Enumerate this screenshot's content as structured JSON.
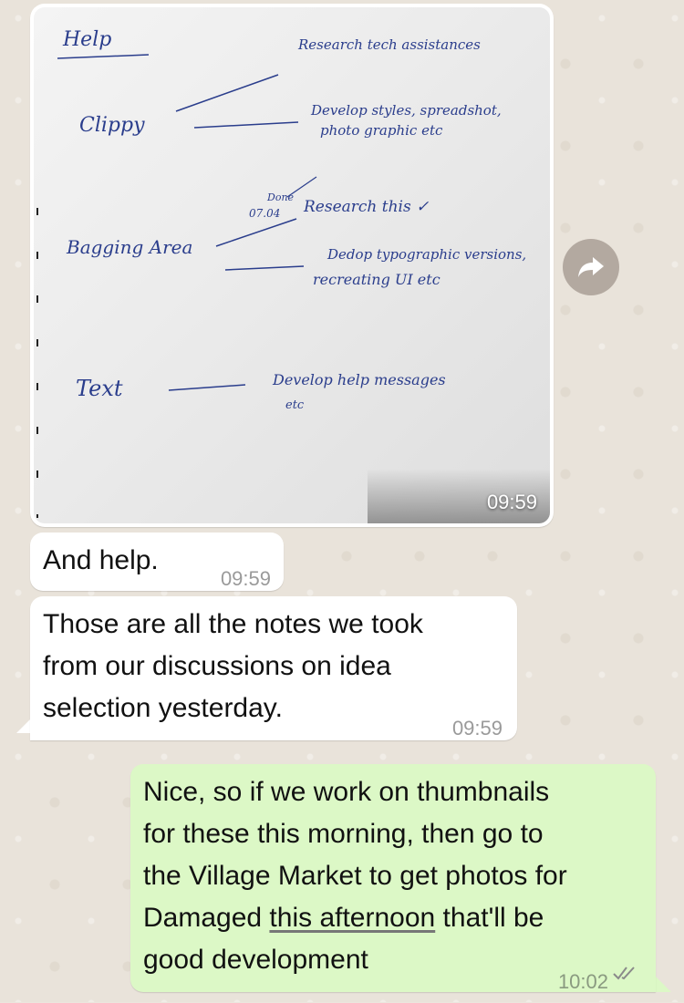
{
  "messages": {
    "image_message": {
      "time": "09:59",
      "photo_notes": {
        "title": "Help",
        "row1_label": "Clippy",
        "row1_note1": "Research tech assistances",
        "row1_note2_line1": "Develop styles, spreadshot,",
        "row1_note2_line2": "photo graphic etc",
        "row2_label": "Bagging Area",
        "row2_done": "Done",
        "row2_date": "07.04",
        "row2_note1": "Research this ✓",
        "row2_note2_line1": "Dedop typographic versions,",
        "row2_note2_line2": "recreating UI etc",
        "row3_label": "Text",
        "row3_note_line1": "Develop help messages",
        "row3_note_line2": "etc"
      }
    },
    "msg1": {
      "text": "And help.",
      "time": "09:59"
    },
    "msg2": {
      "line1": "Those are all the notes we took",
      "line2": "from our discussions on idea",
      "line3": "selection yesterday.",
      "time": "09:59"
    },
    "msg3": {
      "line1": "Nice, so if we work on thumbnails",
      "line2": "for these this morning, then go to",
      "line3": "the Village Market to get photos for",
      "line4_pre": "Damaged ",
      "line4_link": "this afternoon",
      "line4_post": " that'll be",
      "line5": "good development",
      "time": "10:02"
    }
  },
  "icons": {
    "forward": "forward-arrow-icon",
    "read_receipt": "double-check-icon"
  },
  "colors": {
    "incoming_bubble": "#ffffff",
    "outgoing_bubble": "#dcf8c6",
    "read_tick": "#8a8a8a"
  }
}
